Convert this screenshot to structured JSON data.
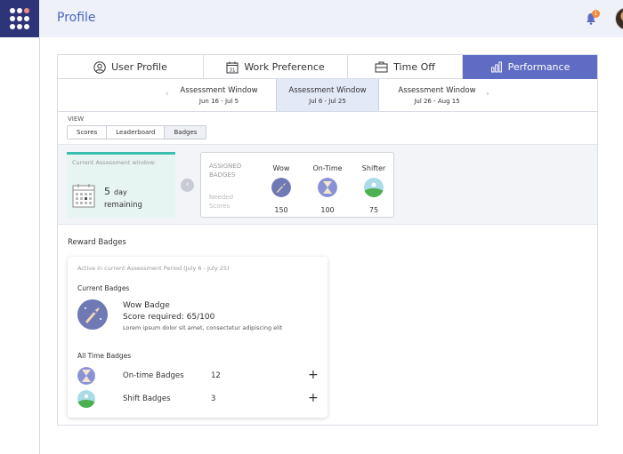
{
  "header": {
    "title": "Profile",
    "notification_count": "1"
  },
  "tabs": [
    {
      "label": "User Profile",
      "icon": "user-circle-icon"
    },
    {
      "label": "Work Preference",
      "icon": "calendar-31-icon"
    },
    {
      "label": "Time Off",
      "icon": "briefcase-icon"
    },
    {
      "label": "Performance",
      "icon": "bar-chart-icon",
      "active": true
    }
  ],
  "windows": [
    {
      "title": "Assessment Window",
      "dates": "Jun 16 - Jul 5"
    },
    {
      "title": "Assessment Window",
      "dates": "Jul 6 - Jul 25",
      "active": true
    },
    {
      "title": "Assessment Window",
      "dates": "Jul 26 - Aug 15"
    }
  ],
  "view": {
    "label": "VIEW",
    "options": [
      "Scores",
      "Leaderboard",
      "Badges"
    ],
    "selected": "Badges"
  },
  "current_window": {
    "label": "Current Assessment window:",
    "days": "5",
    "unit": "day",
    "remaining": "remaining"
  },
  "assigned": {
    "title": "ASSIGNED BADGES",
    "needed": "Needed Scores",
    "badges": [
      {
        "name": "Wow",
        "score": "150",
        "color": "#6f79b4"
      },
      {
        "name": "On-Time",
        "score": "100",
        "color": "#8a92d6"
      },
      {
        "name": "Shifter",
        "score": "75",
        "color": "#7cc4d8"
      }
    ]
  },
  "rewards": {
    "title": "Reward Badges",
    "active_period": "Active in current Assessment Period (July 6 - July 25)",
    "current_label": "Current Badges",
    "current": {
      "name": "Wow Badge",
      "score": "Score required: 65/100",
      "desc": "Lorem ipsum dolor sit amet, consectetur adipiscing elit"
    },
    "alltime_label": "All Time Badges",
    "alltime": [
      {
        "name": "On-time Badges",
        "count": "12",
        "action": "+"
      },
      {
        "name": "Shift Badges",
        "count": "3",
        "action": "+"
      }
    ]
  },
  "colors": {
    "brand": "#2d3478",
    "accent": "#5f6cc4",
    "teal": "#3bbfb0",
    "link": "#4a66c4"
  }
}
